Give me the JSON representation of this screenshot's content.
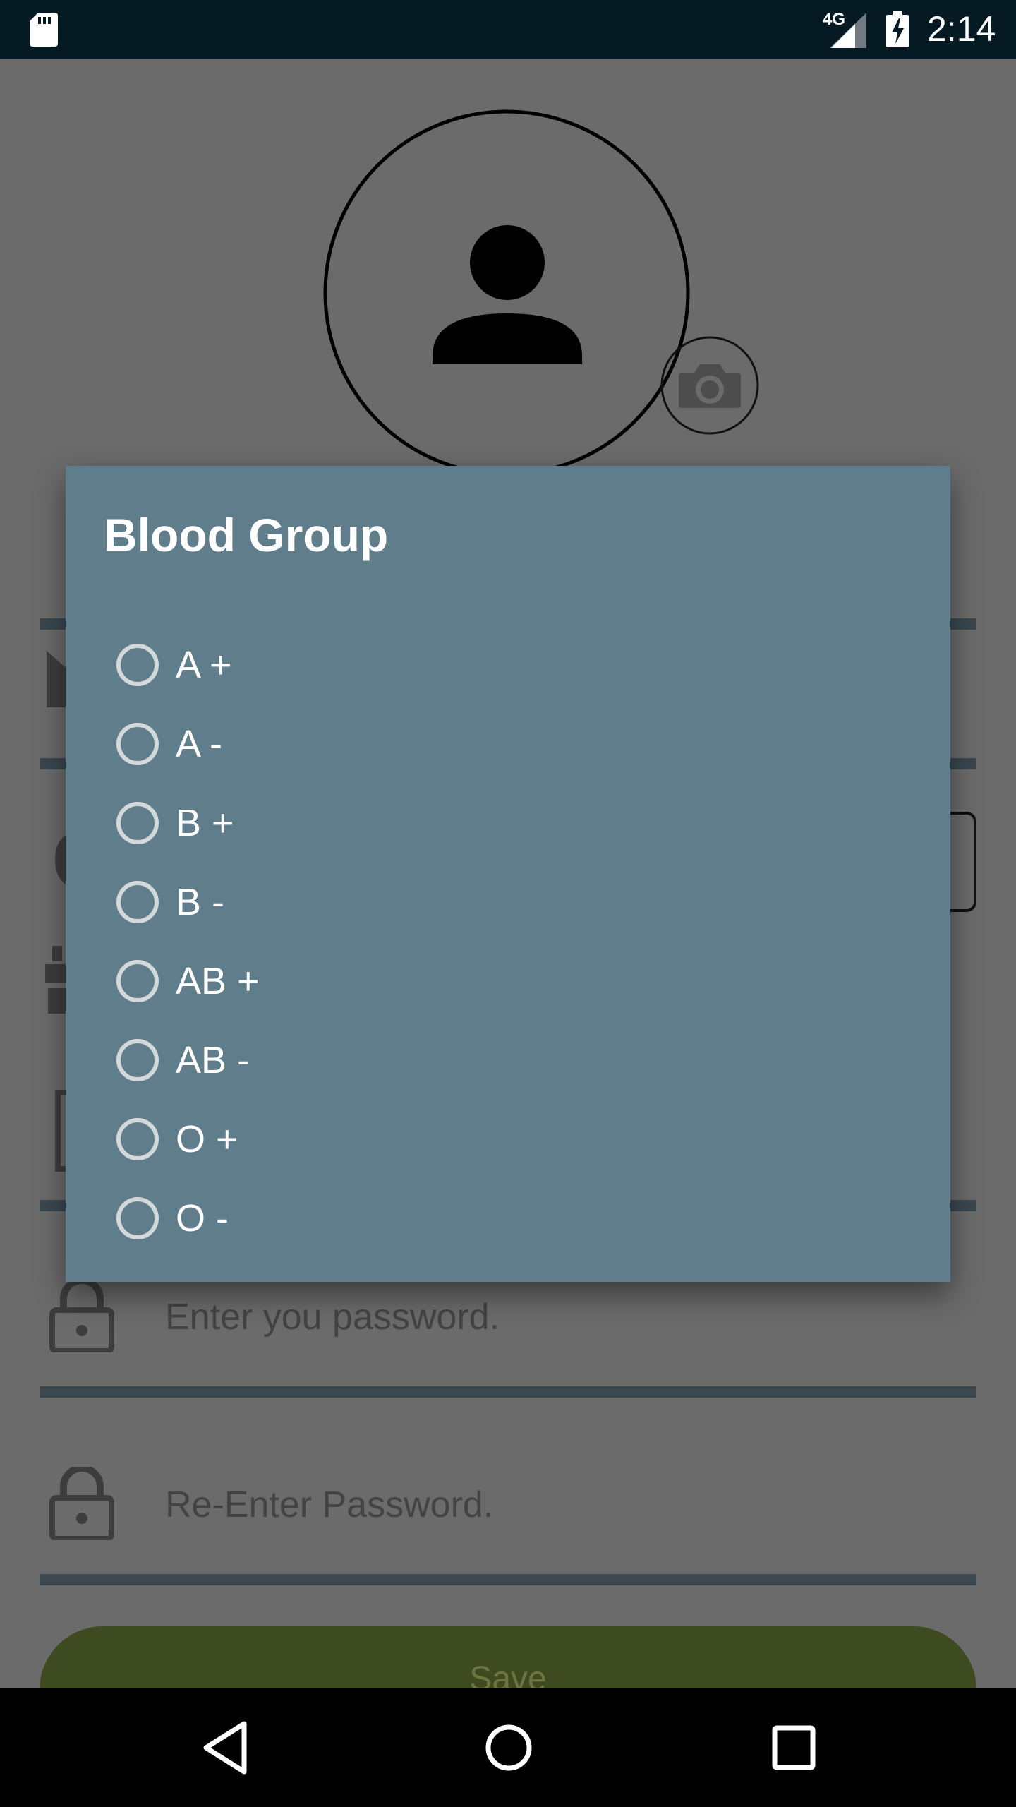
{
  "status_bar": {
    "network": "4G",
    "time": "2:14",
    "icons": [
      "sd-card-icon",
      "signal-icon",
      "battery-charging-icon"
    ]
  },
  "background_form": {
    "password_placeholder": "Enter you password.",
    "reenter_placeholder": "Re-Enter Password.",
    "save_label": "Save",
    "save_color": "#3e4a1f"
  },
  "dialog": {
    "title": "Blood Group",
    "background_color": "#607d8b",
    "options": [
      {
        "label": "A +",
        "selected": false
      },
      {
        "label": "A -",
        "selected": false
      },
      {
        "label": "B +",
        "selected": false
      },
      {
        "label": "B -",
        "selected": false
      },
      {
        "label": "AB +",
        "selected": false
      },
      {
        "label": "AB -",
        "selected": false
      },
      {
        "label": "O +",
        "selected": false
      },
      {
        "label": "O -",
        "selected": false
      }
    ]
  },
  "nav_bar": {
    "icons": [
      "back-icon",
      "home-icon",
      "recents-icon"
    ]
  }
}
